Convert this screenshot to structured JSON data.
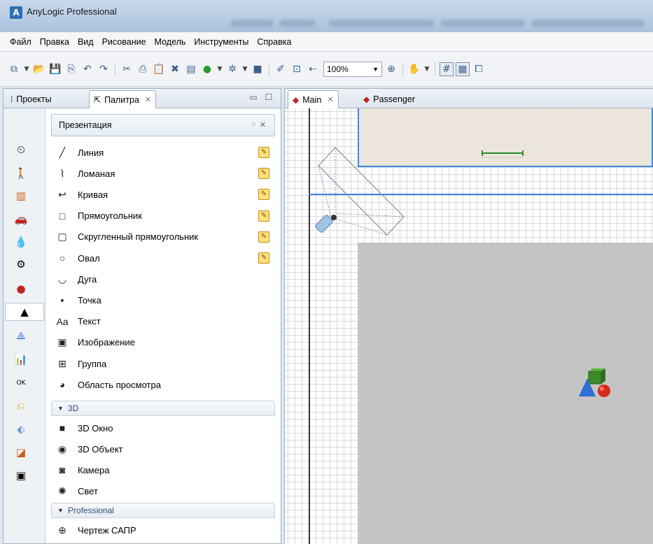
{
  "window": {
    "title": "AnyLogic Professional",
    "app_icon_letter": "A"
  },
  "menu": [
    "Файл",
    "Правка",
    "Вид",
    "Рисование",
    "Модель",
    "Инструменты",
    "Справка"
  ],
  "toolbar": {
    "zoom_value": "100%"
  },
  "left_tabs": {
    "projects": "Проекты",
    "palette": "Палитра"
  },
  "palette": {
    "header": "Презентация",
    "items": [
      {
        "label": "Линия",
        "icon": "line-icon",
        "glyph": "╱",
        "draw_mode": true
      },
      {
        "label": "Ломаная",
        "icon": "polyline-icon",
        "glyph": "⌇",
        "draw_mode": true
      },
      {
        "label": "Кривая",
        "icon": "curve-icon",
        "glyph": "↩",
        "draw_mode": true
      },
      {
        "label": "Прямоугольник",
        "icon": "rectangle-icon",
        "glyph": "□",
        "draw_mode": true
      },
      {
        "label": "Скругленный прямоугольник",
        "icon": "rounded-rectangle-icon",
        "glyph": "▢",
        "draw_mode": true
      },
      {
        "label": "Овал",
        "icon": "oval-icon",
        "glyph": "○",
        "draw_mode": true
      },
      {
        "label": "Дуга",
        "icon": "arc-icon",
        "glyph": "◡"
      },
      {
        "label": "Точка",
        "icon": "point-icon",
        "glyph": "▪"
      },
      {
        "label": "Текст",
        "icon": "text-icon",
        "glyph": "Aa"
      },
      {
        "label": "Изображение",
        "icon": "image-icon",
        "glyph": "▣"
      },
      {
        "label": "Группа",
        "icon": "group-icon",
        "glyph": "⊞"
      },
      {
        "label": "Область просмотра",
        "icon": "view-area-icon",
        "glyph": "◕"
      }
    ],
    "section_3d": "3D",
    "items_3d": [
      {
        "label": "3D Окно",
        "icon": "3d-window-icon",
        "glyph": "■"
      },
      {
        "label": "3D Объект",
        "icon": "3d-object-icon",
        "glyph": "◉"
      },
      {
        "label": "Камера",
        "icon": "camera-icon",
        "glyph": "◙"
      },
      {
        "label": "Свет",
        "icon": "light-icon",
        "glyph": "✺"
      }
    ],
    "section_professional": "Professional",
    "items_professional": [
      {
        "label": "Чертеж САПР",
        "icon": "cad-drawing-icon",
        "glyph": "⊕"
      }
    ]
  },
  "editor_tabs": {
    "main": "Main",
    "passenger": "Passenger"
  },
  "colors": {
    "accent_blue": "#3f87e0",
    "room_fill": "#ebe5dc",
    "area_grey": "#c4c4c4",
    "pencil_yellow": "#ffe27a"
  }
}
